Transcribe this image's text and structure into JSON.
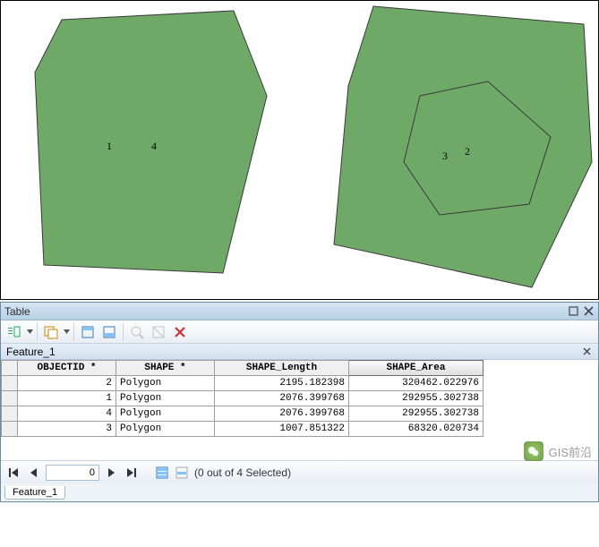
{
  "map": {
    "left_labels": {
      "a": "1",
      "b": "4"
    },
    "right_labels": {
      "a": "3",
      "b": "2"
    }
  },
  "table_panel": {
    "title": "Table",
    "layer_name": "Feature_1",
    "columns": [
      "OBJECTID *",
      "SHAPE *",
      "SHAPE_Length",
      "SHAPE_Area"
    ],
    "sort_column_index": 3,
    "rows": [
      {
        "objectid": "2",
        "shape": "Polygon",
        "length": "2195.182398",
        "area": "320462.022976"
      },
      {
        "objectid": "1",
        "shape": "Polygon",
        "length": "2076.399768",
        "area": "292955.302738"
      },
      {
        "objectid": "4",
        "shape": "Polygon",
        "length": "2076.399768",
        "area": "292955.302738"
      },
      {
        "objectid": "3",
        "shape": "Polygon",
        "length": "1007.851322",
        "area": "68320.020734"
      }
    ],
    "nav": {
      "position": "0",
      "status": "(0 out of 4 Selected)"
    },
    "tab": "Feature_1"
  },
  "watermark": {
    "text": "GIS前沿"
  }
}
